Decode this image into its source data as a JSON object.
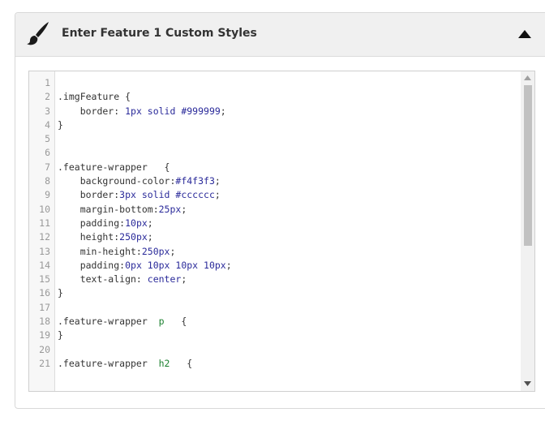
{
  "panel": {
    "title": "Enter Feature 1 Custom Styles",
    "icon": "paintbrush-icon",
    "collapse_icon": "triangle-up-icon"
  },
  "editor": {
    "lines": [
      {
        "n": "1",
        "tokens": []
      },
      {
        "n": "2",
        "tokens": [
          {
            "t": "sel",
            "v": ".imgFeature {"
          }
        ]
      },
      {
        "n": "3",
        "tokens": [
          {
            "t": "prop",
            "v": "    border: "
          },
          {
            "t": "val",
            "v": "1px solid #999999"
          },
          {
            "t": "prop",
            "v": ";"
          }
        ]
      },
      {
        "n": "4",
        "tokens": [
          {
            "t": "sel",
            "v": "}"
          }
        ]
      },
      {
        "n": "5",
        "tokens": []
      },
      {
        "n": "6",
        "tokens": []
      },
      {
        "n": "7",
        "tokens": [
          {
            "t": "sel",
            "v": ".feature-wrapper   {"
          }
        ]
      },
      {
        "n": "8",
        "tokens": [
          {
            "t": "prop",
            "v": "    background-color:"
          },
          {
            "t": "val",
            "v": "#f4f3f3"
          },
          {
            "t": "prop",
            "v": ";"
          }
        ]
      },
      {
        "n": "9",
        "tokens": [
          {
            "t": "prop",
            "v": "    border:"
          },
          {
            "t": "val",
            "v": "3px solid #cccccc"
          },
          {
            "t": "prop",
            "v": ";"
          }
        ]
      },
      {
        "n": "10",
        "tokens": [
          {
            "t": "prop",
            "v": "    margin-bottom:"
          },
          {
            "t": "val",
            "v": "25px"
          },
          {
            "t": "prop",
            "v": ";"
          }
        ]
      },
      {
        "n": "11",
        "tokens": [
          {
            "t": "prop",
            "v": "    padding:"
          },
          {
            "t": "val",
            "v": "10px"
          },
          {
            "t": "prop",
            "v": ";"
          }
        ]
      },
      {
        "n": "12",
        "tokens": [
          {
            "t": "prop",
            "v": "    height:"
          },
          {
            "t": "val",
            "v": "250px"
          },
          {
            "t": "prop",
            "v": ";"
          }
        ]
      },
      {
        "n": "13",
        "tokens": [
          {
            "t": "prop",
            "v": "    min-height:"
          },
          {
            "t": "val",
            "v": "250px"
          },
          {
            "t": "prop",
            "v": ";"
          }
        ]
      },
      {
        "n": "14",
        "tokens": [
          {
            "t": "prop",
            "v": "    padding:"
          },
          {
            "t": "val",
            "v": "0px 10px 10px 10px"
          },
          {
            "t": "prop",
            "v": ";"
          }
        ]
      },
      {
        "n": "15",
        "tokens": [
          {
            "t": "prop",
            "v": "    text-align: "
          },
          {
            "t": "val",
            "v": "center"
          },
          {
            "t": "prop",
            "v": ";"
          }
        ]
      },
      {
        "n": "16",
        "tokens": [
          {
            "t": "sel",
            "v": "}"
          }
        ]
      },
      {
        "n": "17",
        "tokens": []
      },
      {
        "n": "18",
        "tokens": [
          {
            "t": "sel",
            "v": ".feature-wrapper  "
          },
          {
            "t": "htag",
            "v": "p"
          },
          {
            "t": "sel",
            "v": "   {"
          }
        ]
      },
      {
        "n": "19",
        "tokens": [
          {
            "t": "sel",
            "v": "}"
          }
        ]
      },
      {
        "n": "20",
        "tokens": []
      },
      {
        "n": "21",
        "tokens": [
          {
            "t": "sel",
            "v": ".feature-wrapper  "
          },
          {
            "t": "htag",
            "v": "h2"
          },
          {
            "t": "sel",
            "v": "   {"
          }
        ]
      }
    ]
  },
  "colors": {
    "header_bg": "#f0f0f0",
    "value_text": "#2a2a9a",
    "tag_text": "#1a7f2e",
    "line_number": "#999999"
  }
}
